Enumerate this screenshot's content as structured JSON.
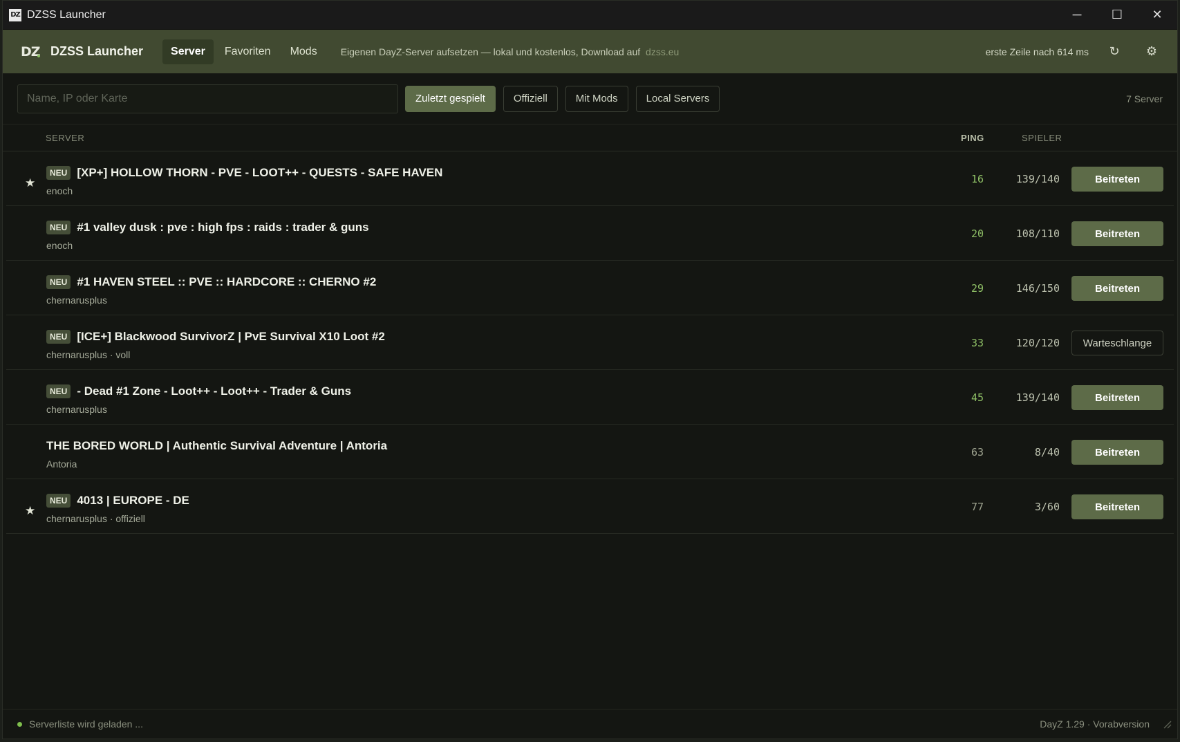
{
  "window": {
    "logo": "DZ",
    "title": "DZSS Launcher",
    "controls": {
      "minimize": "─",
      "maximize": "☐",
      "close": "✕"
    }
  },
  "header": {
    "logo": "DZ",
    "app_name": "DZSS Launcher",
    "nav": [
      {
        "label": "Server",
        "active": true
      },
      {
        "label": "Favoriten",
        "active": false
      },
      {
        "label": "Mods",
        "active": false
      }
    ],
    "promo_text": "Eigenen DayZ-Server aufsetzen — lokal und kostenlos, Download auf",
    "promo_link": "dzss.eu",
    "status": "erste Zeile nach 614 ms",
    "refresh_icon": "↻",
    "settings_icon": "⚙"
  },
  "filters": {
    "search_placeholder": "Name, IP oder Karte",
    "chips": [
      {
        "label": "Zuletzt gespielt",
        "active": true
      },
      {
        "label": "Offiziell",
        "active": false
      },
      {
        "label": "Mit Mods",
        "active": false
      },
      {
        "label": "Local Servers",
        "active": false
      }
    ],
    "count": "7 Server"
  },
  "table": {
    "headers": {
      "server": "SERVER",
      "ping": "PING",
      "players": "SPIELER"
    },
    "rows": [
      {
        "favorite": true,
        "badge": "NEU",
        "name": "[XP+] HOLLOW THORN - PVE - LOOT++ - QUESTS - SAFE HAVEN",
        "sub": "enoch",
        "ping": "16",
        "players": "139/140",
        "action": "Beitreten"
      },
      {
        "favorite": false,
        "badge": "NEU",
        "name": "#1 valley dusk : pve : high fps : raids : trader & guns",
        "sub": "enoch",
        "ping": "20",
        "players": "108/110",
        "action": "Beitreten"
      },
      {
        "favorite": false,
        "badge": "NEU",
        "name": "#1 HAVEN STEEL :: PVE :: HARDCORE :: CHERNO #2",
        "sub": "chernarusplus",
        "ping": "29",
        "players": "146/150",
        "action": "Beitreten"
      },
      {
        "favorite": false,
        "badge": "NEU",
        "name": "[ICE+] Blackwood SurvivorZ | PvE Survival X10 Loot #2",
        "sub": "chernarusplus · voll",
        "ping": "33",
        "players": "120/120",
        "action": "Warteschlange"
      },
      {
        "favorite": false,
        "badge": "NEU",
        "name": "- Dead #1 Zone - Loot++ - Loot++ - Trader & Guns",
        "sub": "chernarusplus",
        "ping": "45",
        "players": "139/140",
        "action": "Beitreten"
      },
      {
        "favorite": false,
        "badge": "",
        "name": "THE BORED WORLD | Authentic Survival Adventure | Antoria",
        "sub": "Antoria",
        "ping": "63",
        "players": "8/40",
        "action": "Beitreten"
      },
      {
        "favorite": true,
        "badge": "NEU",
        "name": "4013 | EUROPE - DE",
        "sub": "chernarusplus · offiziell",
        "ping": "77",
        "players": "3/60",
        "action": "Beitreten"
      }
    ],
    "star_icon": "★"
  },
  "statusbar": {
    "text": "Serverliste wird geladen ...",
    "version": "DayZ 1.29 · Vorabversion"
  }
}
